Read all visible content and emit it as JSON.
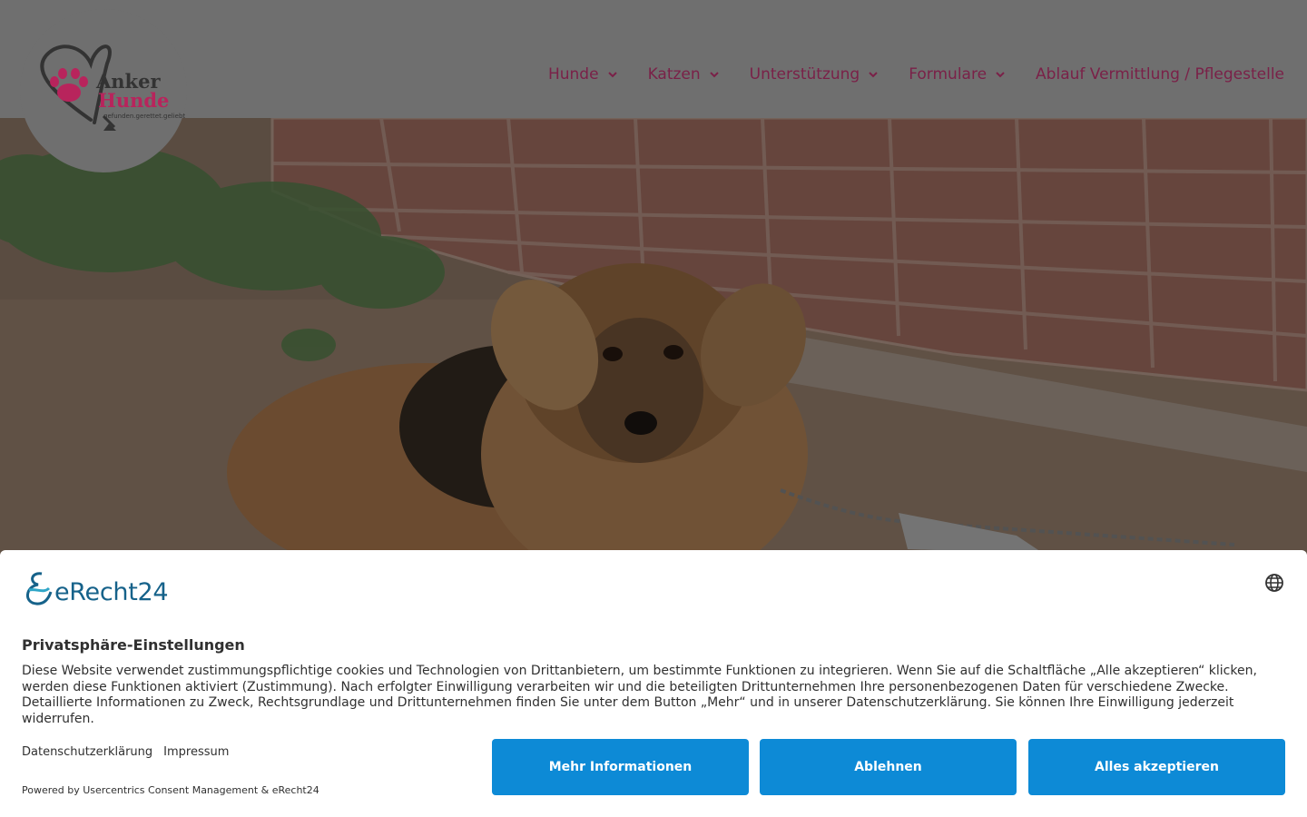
{
  "header": {
    "logo": {
      "line1": "Anker",
      "line2": "Hunde",
      "tagline": "gefunden.gerettet.geliebt"
    },
    "nav": [
      {
        "label": "Hunde",
        "has_dropdown": true
      },
      {
        "label": "Katzen",
        "has_dropdown": true
      },
      {
        "label": "Unterstützung",
        "has_dropdown": true
      },
      {
        "label": "Formulare",
        "has_dropdown": true
      },
      {
        "label": "Ablauf Vermittlung / Pflegestelle",
        "has_dropdown": false
      }
    ]
  },
  "consent": {
    "brand": "eRecht24",
    "language_icon": "globe-icon",
    "title": "Privatsphäre-Einstellungen",
    "body": "Diese Website verwendet zustimmungspflichtige cookies und Technologien von Drittanbietern, um bestimmte Funktionen zu integrieren. Wenn Sie auf die Schaltfläche „Alle akzeptieren“ klicken, werden diese Funktionen aktiviert (Zustimmung). Nach erfolgter Einwilligung verarbeiten wir und die beteiligten Drittunternehmen Ihre personenbezogenen Daten für verschiedene Zwecke. Detaillierte Informationen zu Zweck, Rechtsgrundlage und Drittunternehmen finden Sie unter dem Button „Mehr“ und in unserer Datenschutzerklärung. Sie können Ihre Einwilligung jederzeit widerrufen.",
    "links": {
      "privacy": "Datenschutzerklärung",
      "imprint": "Impressum"
    },
    "powered_by": "Powered by Usercentrics Consent Management & eRecht24",
    "buttons": {
      "more": "Mehr Informationen",
      "decline": "Ablehnen",
      "accept": "Alles akzeptieren"
    }
  },
  "colors": {
    "nav_text": "#7a2148",
    "button_bg": "#0d8ad6",
    "brand_blue": "#16628a",
    "logo_pink": "#b8245c"
  }
}
